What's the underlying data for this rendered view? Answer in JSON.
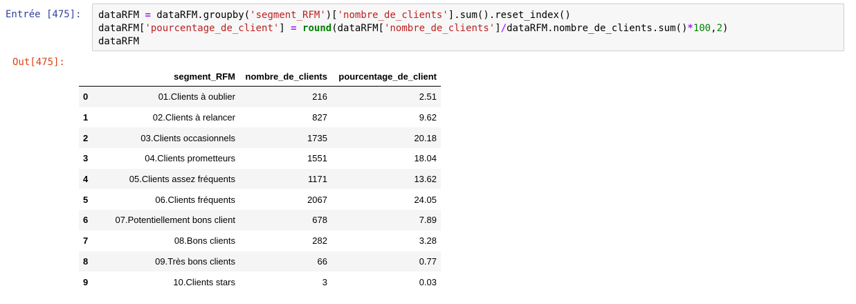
{
  "input_prompt": "Entrée [475]:",
  "output_prompt": "Out[475]:",
  "code": {
    "line1": [
      {
        "t": "plain",
        "v": "dataRFM "
      },
      {
        "t": "op",
        "v": "="
      },
      {
        "t": "plain",
        "v": " dataRFM.groupby("
      },
      {
        "t": "str",
        "v": "'segment_RFM'"
      },
      {
        "t": "plain",
        "v": ")["
      },
      {
        "t": "str",
        "v": "'nombre_de_clients'"
      },
      {
        "t": "plain",
        "v": "].sum().reset_index()"
      }
    ],
    "line2": [
      {
        "t": "plain",
        "v": "dataRFM["
      },
      {
        "t": "str",
        "v": "'pourcentage_de_client'"
      },
      {
        "t": "plain",
        "v": "] "
      },
      {
        "t": "op",
        "v": "="
      },
      {
        "t": "plain",
        "v": " "
      },
      {
        "t": "kw",
        "v": "round"
      },
      {
        "t": "plain",
        "v": "(dataRFM["
      },
      {
        "t": "str",
        "v": "'nombre_de_clients'"
      },
      {
        "t": "plain",
        "v": "]"
      },
      {
        "t": "op",
        "v": "/"
      },
      {
        "t": "plain",
        "v": "dataRFM.nombre_de_clients.sum()"
      },
      {
        "t": "op",
        "v": "*"
      },
      {
        "t": "num",
        "v": "100"
      },
      {
        "t": "plain",
        "v": ","
      },
      {
        "t": "num",
        "v": "2"
      },
      {
        "t": "plain",
        "v": ")"
      }
    ],
    "line3": [
      {
        "t": "plain",
        "v": "dataRFM"
      }
    ]
  },
  "table": {
    "columns": [
      "",
      "segment_RFM",
      "nombre_de_clients",
      "pourcentage_de_client"
    ],
    "rows": [
      {
        "index": "0",
        "segment_RFM": "01.Clients à oublier",
        "nombre_de_clients": "216",
        "pourcentage_de_client": "2.51"
      },
      {
        "index": "1",
        "segment_RFM": "02.Clients à relancer",
        "nombre_de_clients": "827",
        "pourcentage_de_client": "9.62"
      },
      {
        "index": "2",
        "segment_RFM": "03.Clients occasionnels",
        "nombre_de_clients": "1735",
        "pourcentage_de_client": "20.18"
      },
      {
        "index": "3",
        "segment_RFM": "04.Clients prometteurs",
        "nombre_de_clients": "1551",
        "pourcentage_de_client": "18.04"
      },
      {
        "index": "4",
        "segment_RFM": "05.Clients assez fréquents",
        "nombre_de_clients": "1171",
        "pourcentage_de_client": "13.62"
      },
      {
        "index": "5",
        "segment_RFM": "06.Clients fréquents",
        "nombre_de_clients": "2067",
        "pourcentage_de_client": "24.05"
      },
      {
        "index": "6",
        "segment_RFM": "07.Potentiellement bons client",
        "nombre_de_clients": "678",
        "pourcentage_de_client": "7.89"
      },
      {
        "index": "7",
        "segment_RFM": "08.Bons clients",
        "nombre_de_clients": "282",
        "pourcentage_de_client": "3.28"
      },
      {
        "index": "8",
        "segment_RFM": "09.Très bons clients",
        "nombre_de_clients": "66",
        "pourcentage_de_client": "0.77"
      },
      {
        "index": "9",
        "segment_RFM": "10.Clients stars",
        "nombre_de_clients": "3",
        "pourcentage_de_client": "0.03"
      }
    ]
  },
  "colors": {
    "input_prompt": "#303f9f",
    "output_prompt": "#d84315",
    "code_bg": "#f7f7f7",
    "string": "#ba2121",
    "operator": "#aa22ff",
    "keyword": "#008000",
    "number": "#008000",
    "row_stripe": "#f5f5f5"
  }
}
